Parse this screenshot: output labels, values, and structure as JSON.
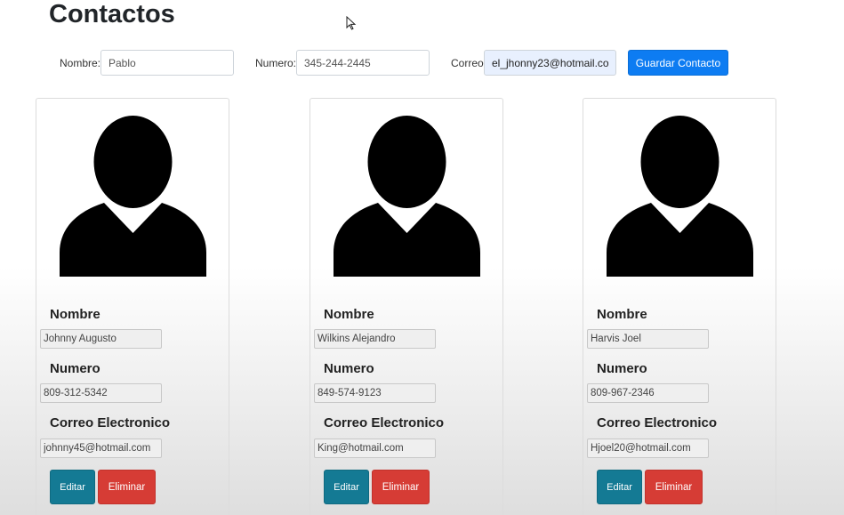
{
  "page": {
    "title": "Contactos"
  },
  "form": {
    "nombre_label": "Nombre:",
    "nombre_value": "Pablo",
    "numero_label": "Numero:",
    "numero_value": "345-244-2445",
    "correo_label": "Correo",
    "correo_value": "el_jhonny23@hotmail.co",
    "save_label": "Guardar Contacto"
  },
  "cards": [
    {
      "nombre_label": "Nombre",
      "nombre": "Johnny Augusto",
      "numero_label": "Numero",
      "numero": "809-312-5342",
      "correo_label": "Correo Electronico",
      "correo": "johnny45@hotmail.com",
      "edit_label": "Editar",
      "delete_label": "Eliminar"
    },
    {
      "nombre_label": "Nombre",
      "nombre": "Wilkins Alejandro",
      "numero_label": "Numero",
      "numero": "849-574-9123",
      "correo_label": "Correo Electronico",
      "correo": "King@hotmail.com",
      "edit_label": "Editar",
      "delete_label": "Eliminar"
    },
    {
      "nombre_label": "Nombre",
      "nombre": "Harvis Joel",
      "numero_label": "Numero",
      "numero": "809-967-2346",
      "correo_label": "Correo Electronico",
      "correo": "Hjoel20@hotmail.com",
      "edit_label": "Editar",
      "delete_label": "Eliminar"
    }
  ],
  "colors": {
    "primary": "#0d7cf2",
    "edit": "#147a94",
    "delete": "#d63c35",
    "autofill": "#e8f0fe"
  },
  "icons": {
    "avatar": "person-silhouette-icon",
    "cursor": "mouse-pointer-icon"
  }
}
